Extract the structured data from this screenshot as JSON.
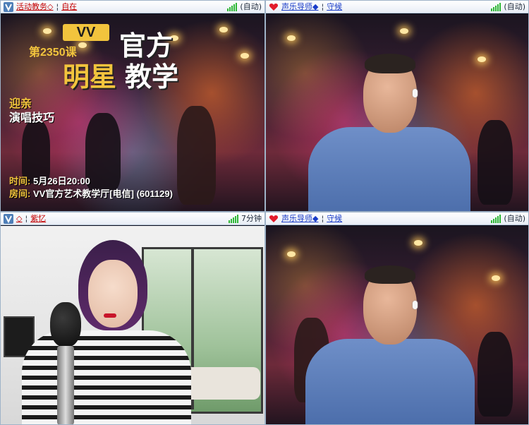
{
  "panels": {
    "top": {
      "icon": "shield-badge-icon",
      "name": "活动教务◇",
      "separator": "¦",
      "status_word": "自在",
      "mode": "(自动)",
      "banner": {
        "vv": "VV",
        "course": "第2350课",
        "title_white": "官方",
        "title_yellow": "明星",
        "title_white2": "教学",
        "subtitle_line1": "迎亲",
        "subtitle_line2": "演唱技巧",
        "time_label": "时间:",
        "time_value": "5月26日20:00",
        "room_label": "房间:",
        "room_value": "VV官方艺术教学厅[电信] (601129)"
      }
    },
    "top_right_header": {
      "icon": "heart-icon",
      "name": "声乐导师◆",
      "separator": "¦",
      "status_word": "守候",
      "mode": "(自动)"
    },
    "bottom_left": {
      "icon": "shield-badge-icon",
      "name": "◇",
      "separator": "¦",
      "status_word": "紫忆",
      "duration": "7分钟"
    },
    "bottom_right": {
      "icon": "heart-icon",
      "name": "声乐导师◆",
      "separator": "¦",
      "status_word": "守候",
      "mode": "(自动)"
    }
  },
  "colors": {
    "accent_yellow": "#f2c43d",
    "name_red": "#c40000",
    "name_blue": "#1a3cc8",
    "signal_green": "#2fb836"
  }
}
